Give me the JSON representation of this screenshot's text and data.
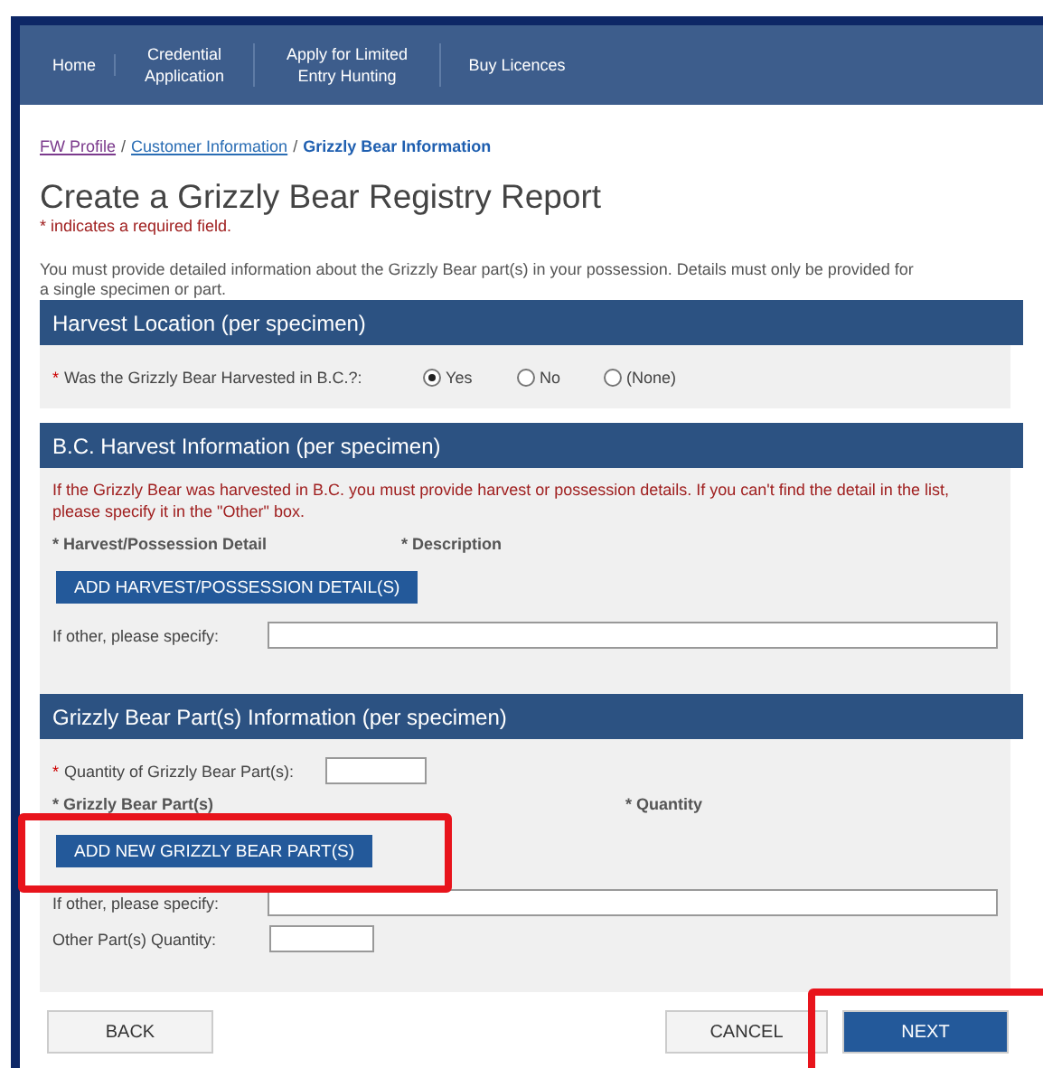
{
  "nav": [
    {
      "label": "Home"
    },
    {
      "label": "Credential Application"
    },
    {
      "label": "Apply for Limited Entry Hunting"
    },
    {
      "label": "Buy Licences"
    }
  ],
  "required_mark": "*",
  "breadcrumb_separator": "/",
  "breadcrumb": [
    {
      "label": "FW Profile",
      "kind": "visited"
    },
    {
      "label": "Customer Information",
      "kind": "link"
    },
    {
      "label": "Grizzly Bear Information",
      "kind": "current"
    }
  ],
  "title": "Create a Grizzly Bear Registry Report",
  "required_note": "* indicates a required field.",
  "intro": "You must provide detailed information about the Grizzly Bear part(s) in your possession. Details must only be provided for a single specimen or part.",
  "harvest_location": {
    "heading": "Harvest Location (per specimen)",
    "question": "Was the Grizzly Bear Harvested in B.C.?:",
    "options": [
      {
        "label": "Yes",
        "selected": true
      },
      {
        "label": "No",
        "selected": false
      },
      {
        "label": "(None)",
        "selected": false
      }
    ]
  },
  "bc_harvest": {
    "heading": "B.C. Harvest Information (per specimen)",
    "notice": "If the Grizzly Bear was harvested in B.C. you must provide harvest or possession details. If you can't find the detail in the list, please specify it in the \"Other\" box.",
    "columns": [
      "* Harvest/Possession Detail",
      "* Description"
    ],
    "add_button": "ADD HARVEST/POSSESSION DETAIL(S)",
    "other_label": "If other, please specify:"
  },
  "parts": {
    "heading": "Grizzly Bear Part(s) Information (per specimen)",
    "quantity_label": "Quantity of Grizzly Bear Part(s):",
    "columns": [
      "* Grizzly Bear Part(s)",
      "* Quantity"
    ],
    "add_button": "ADD NEW GRIZZLY BEAR PART(S)",
    "other_label": "If other, please specify:",
    "other_quantity_label": "Other Part(s) Quantity:"
  },
  "buttons": {
    "back": "BACK",
    "cancel": "CANCEL",
    "next": "NEXT"
  }
}
